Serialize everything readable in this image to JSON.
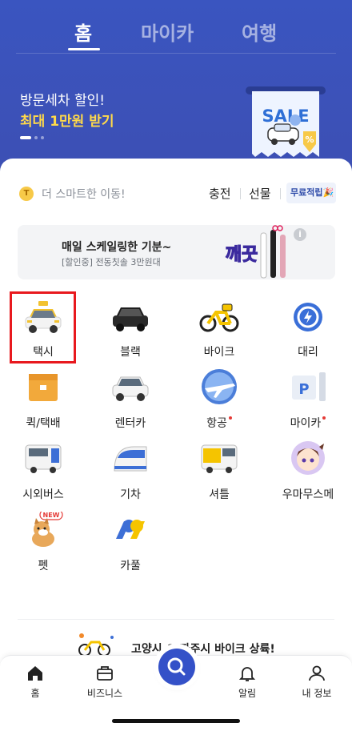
{
  "header": {
    "tabs": [
      {
        "label": "홈",
        "active": true
      },
      {
        "label": "마이카",
        "active": false
      },
      {
        "label": "여행",
        "active": false
      }
    ],
    "background_color": "#3a55c0"
  },
  "promo": {
    "line1": "방문세차 할인!",
    "line2": "최대 1만원 받기",
    "highlight_color": "#ffd94a",
    "sale_label": "SALE",
    "sale_percent": "%"
  },
  "quick": {
    "coin_icon": "T",
    "smart_text": "더 스마트한 이동!",
    "charge_label": "충전",
    "gift_label": "선물",
    "free_badge": "무료적립🎉"
  },
  "ad": {
    "title": "매일 스케일링한 기분~",
    "subtitle": "[할인중] 전동칫솔 3만원대",
    "art_text": "깨끗"
  },
  "services": [
    {
      "label": "택시",
      "icon": "taxi-icon",
      "dot": false
    },
    {
      "label": "블랙",
      "icon": "black-car-icon",
      "dot": false
    },
    {
      "label": "바이크",
      "icon": "bike-icon",
      "dot": false
    },
    {
      "label": "대리",
      "icon": "steering-wheel-icon",
      "dot": false
    },
    {
      "label": "퀵/택배",
      "icon": "delivery-box-icon",
      "dot": false
    },
    {
      "label": "렌터카",
      "icon": "rental-car-icon",
      "dot": false
    },
    {
      "label": "항공",
      "icon": "airplane-icon",
      "dot": true
    },
    {
      "label": "마이카",
      "icon": "parking-icon",
      "dot": true
    },
    {
      "label": "시외버스",
      "icon": "bus-icon",
      "dot": false
    },
    {
      "label": "기차",
      "icon": "train-icon",
      "dot": false
    },
    {
      "label": "셔틀",
      "icon": "shuttle-icon",
      "dot": false
    },
    {
      "label": "우마무스메",
      "icon": "character-icon",
      "dot": false
    },
    {
      "label": "펫",
      "icon": "dog-icon",
      "dot": false,
      "badge": "NEW"
    },
    {
      "label": "카풀",
      "icon": "carpool-icon",
      "dot": false
    }
  ],
  "bottom_promo": {
    "text": "고양시 & 파주시 바이크 상륙!"
  },
  "nav": {
    "items": [
      {
        "label": "홈",
        "icon": "home-icon"
      },
      {
        "label": "비즈니스",
        "icon": "briefcase-icon"
      },
      {
        "label": "",
        "icon": "search-icon"
      },
      {
        "label": "알림",
        "icon": "bell-icon"
      },
      {
        "label": "내 정보",
        "icon": "person-icon"
      }
    ],
    "accent_color": "#3451c8"
  }
}
